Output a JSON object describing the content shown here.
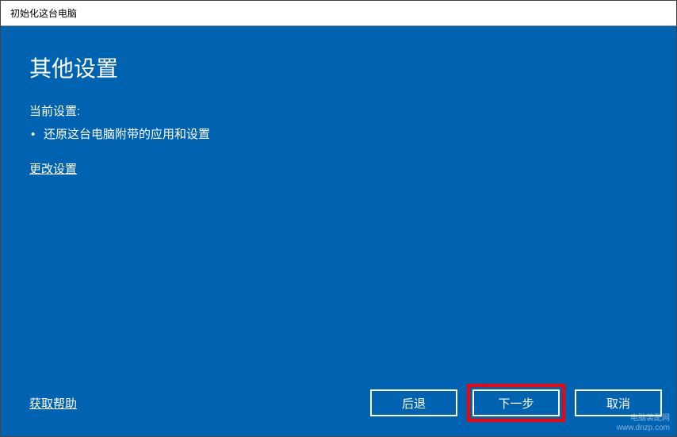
{
  "window": {
    "title": "初始化这台电脑"
  },
  "page": {
    "heading": "其他设置",
    "current_settings_label": "当前设置:",
    "settings_items": [
      "还原这台电脑附带的应用和设置"
    ],
    "change_settings_link": "更改设置"
  },
  "footer": {
    "help_link": "获取帮助",
    "buttons": {
      "back": "后退",
      "next": "下一步",
      "cancel": "取消"
    }
  },
  "watermark": {
    "line1": "电脑装配网",
    "line2": "www.dnzp.com"
  }
}
